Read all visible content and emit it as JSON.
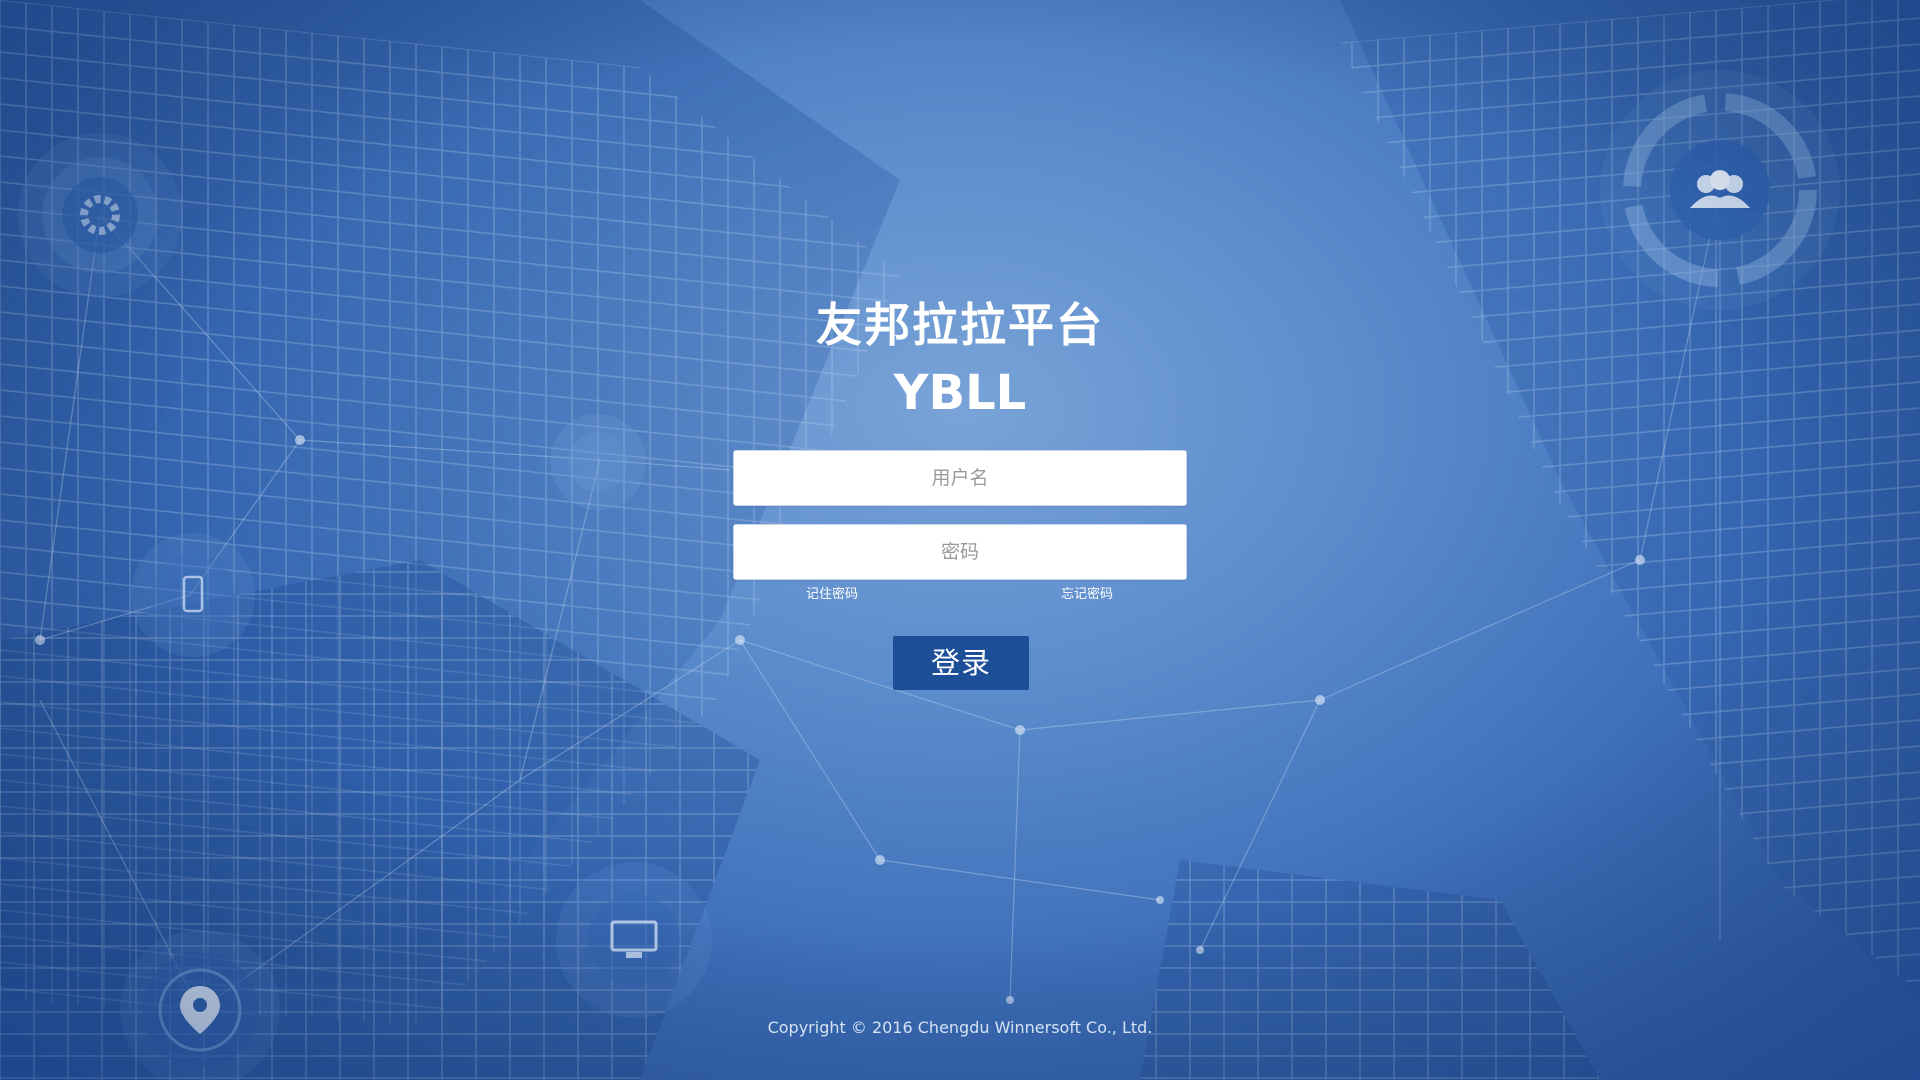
{
  "brand": {
    "title_cn": "友邦拉拉平台",
    "title_en": "YBLL"
  },
  "login_form": {
    "username_placeholder": "用户名",
    "password_placeholder": "密码",
    "remember_label": "记住密码",
    "forgot_label": "忘记密码",
    "submit_label": "登录"
  },
  "footer": {
    "copyright": "Copyright © 2016 Chengdu Winnersoft Co., Ltd."
  },
  "colors": {
    "background": "#4a7ec4",
    "button": "#1c4f97",
    "text": "#ffffff"
  },
  "background_icons": [
    "gear-icon",
    "people-icon",
    "phone-icon",
    "monitor-icon",
    "location-pin-icon",
    "user-icon"
  ]
}
